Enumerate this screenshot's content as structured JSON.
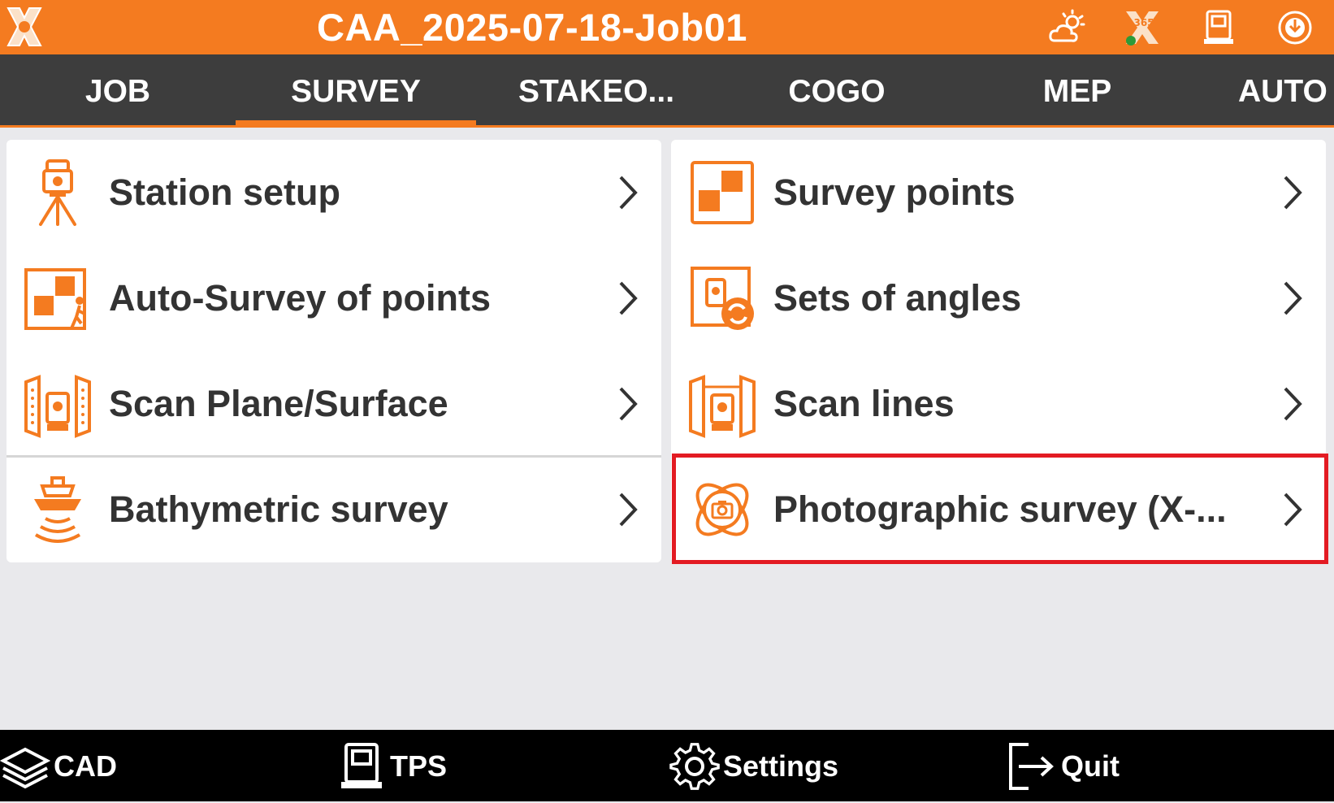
{
  "titlebar": {
    "title": "CAA_2025-07-18-Job01",
    "status_icons": [
      "weather-icon",
      "x365-icon",
      "total-station-icon",
      "connection-icon"
    ],
    "badge_text": "365"
  },
  "tabs": [
    {
      "label": "JOB",
      "active": false
    },
    {
      "label": "SURVEY",
      "active": true
    },
    {
      "label": "STAKEO...",
      "active": false
    },
    {
      "label": "COGO",
      "active": false
    },
    {
      "label": "MEP",
      "active": false
    },
    {
      "label": "AUTO",
      "active": false
    }
  ],
  "menu": {
    "left": [
      {
        "label": "Station setup",
        "icon": "station-setup-icon"
      },
      {
        "label": "Auto-Survey of points",
        "icon": "auto-survey-icon"
      },
      {
        "label": "Scan Plane/Surface",
        "icon": "scan-plane-icon"
      },
      {
        "label": "Bathymetric survey",
        "icon": "bathymetric-icon"
      }
    ],
    "right": [
      {
        "label": "Survey points",
        "icon": "survey-points-icon"
      },
      {
        "label": "Sets of angles",
        "icon": "sets-of-angles-icon"
      },
      {
        "label": "Scan lines",
        "icon": "scan-lines-icon"
      },
      {
        "label": "Photographic survey (X-...",
        "icon": "photographic-survey-icon",
        "highlighted": true
      }
    ]
  },
  "bottombar": [
    {
      "label": "CAD",
      "icon": "layers-icon"
    },
    {
      "label": "TPS",
      "icon": "tps-icon"
    },
    {
      "label": "Settings",
      "icon": "gear-icon"
    },
    {
      "label": "Quit",
      "icon": "quit-icon"
    }
  ],
  "colors": {
    "accent": "#f47b20",
    "tabbar": "#3d3d3d",
    "highlight": "#e31b23",
    "bottombar": "#000000",
    "background": "#e9e9ec"
  }
}
